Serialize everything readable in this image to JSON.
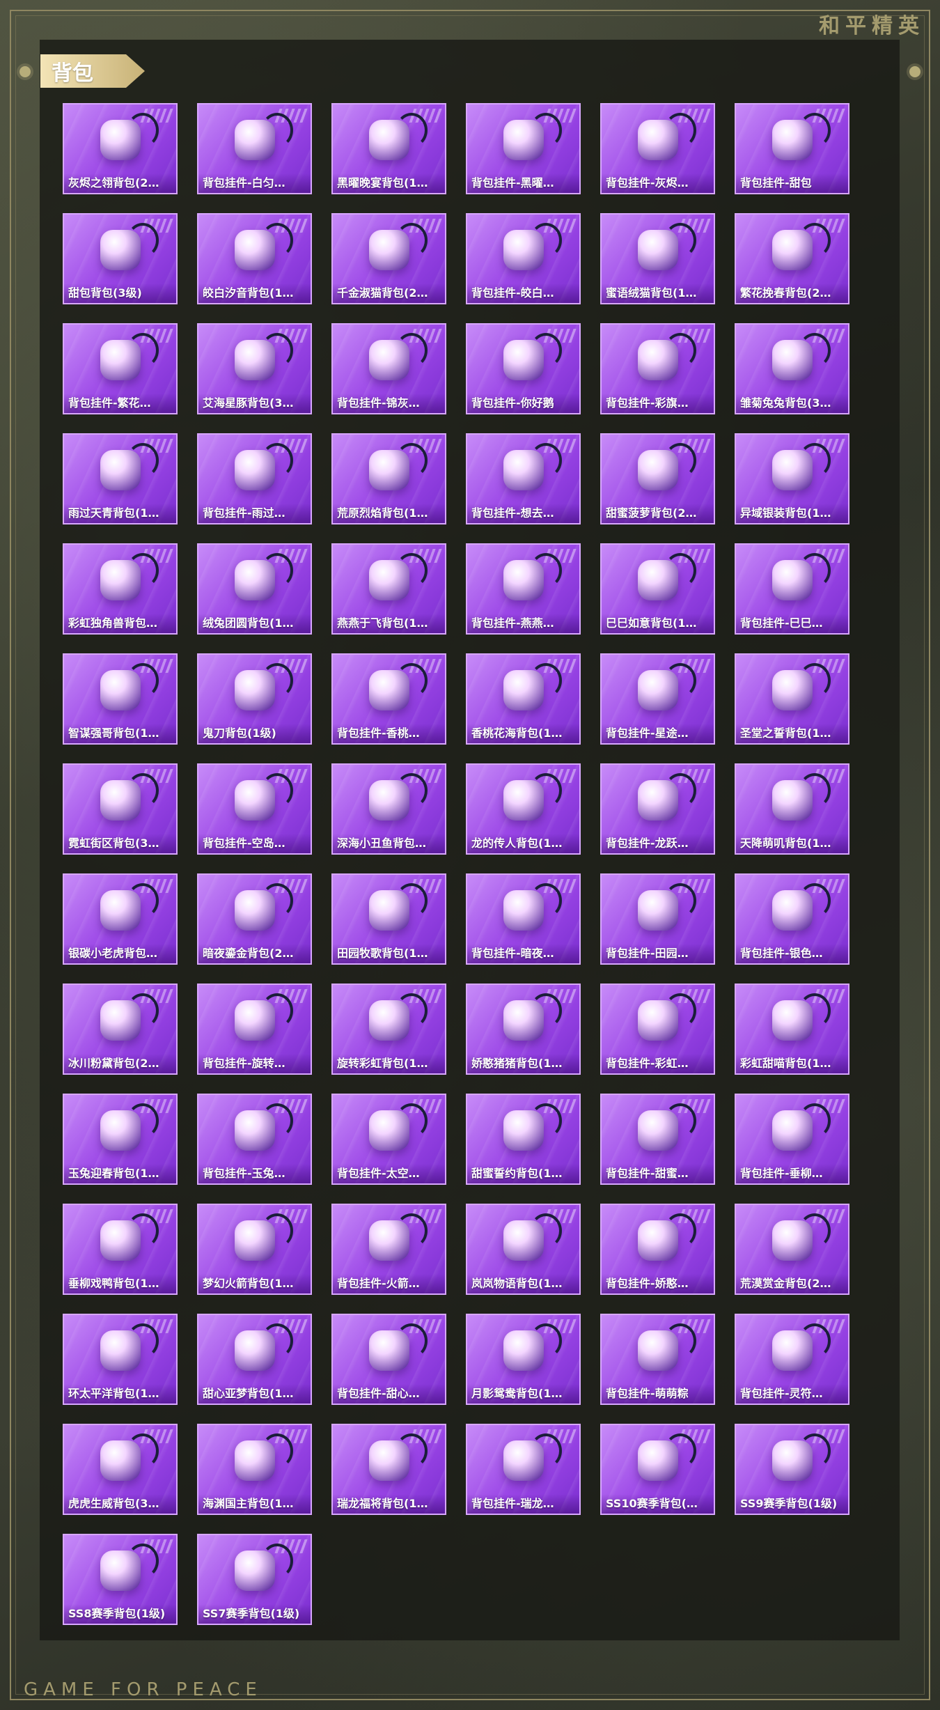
{
  "brand": "和平精英",
  "footer": "GAME FOR PEACE",
  "section_title": "背包",
  "items": [
    "灰烬之翎背包(2…",
    "背包挂件-白匀…",
    "黑曜晚宴背包(1…",
    "背包挂件-黑曜…",
    "背包挂件-灰烬…",
    "背包挂件-甜包",
    "甜包背包(3级)",
    "皎白汐音背包(1…",
    "千金淑猫背包(2…",
    "背包挂件-皎白…",
    "蜜语绒猫背包(1…",
    "繁花挽春背包(2…",
    "背包挂件-繁花…",
    "艾海星豚背包(3…",
    "背包挂件-锦灰…",
    "背包挂件-你好鹅",
    "背包挂件-彩旗…",
    "雏菊兔兔背包(3…",
    "雨过天青背包(1…",
    "背包挂件-雨过…",
    "荒原烈焰背包(1…",
    "背包挂件-想去…",
    "甜蜜菠萝背包(2…",
    "异域银装背包(1…",
    "彩虹独角兽背包…",
    "绒兔团圆背包(1…",
    "燕燕于飞背包(1…",
    "背包挂件-燕燕…",
    "巳巳如意背包(1…",
    "背包挂件-巳巳…",
    "智谋强哥背包(1…",
    "鬼刀背包(1级)",
    "背包挂件-香桃…",
    "香桃花海背包(1…",
    "背包挂件-星途…",
    "圣堂之誓背包(1…",
    "霓虹街区背包(3…",
    "背包挂件-空岛…",
    "深海小丑鱼背包…",
    "龙的传人背包(1…",
    "背包挂件-龙跃…",
    "天降萌叽背包(1…",
    "银碳小老虎背包…",
    "暗夜鎏金背包(2…",
    "田园牧歌背包(1…",
    "背包挂件-暗夜…",
    "背包挂件-田园…",
    "背包挂件-银色…",
    "冰川粉黛背包(2…",
    "背包挂件-旋转…",
    "旋转彩虹背包(1…",
    "娇憨猪猪背包(1…",
    "背包挂件-彩虹…",
    "彩虹甜喵背包(1…",
    "玉兔迎春背包(1…",
    "背包挂件-玉兔…",
    "背包挂件-太空…",
    "甜蜜誓约背包(1…",
    "背包挂件-甜蜜…",
    "背包挂件-垂柳…",
    "垂柳戏鸭背包(1…",
    "梦幻火箭背包(1…",
    "背包挂件-火箭…",
    "岚岚物语背包(1…",
    "背包挂件-娇憨…",
    "荒漠赏金背包(2…",
    "环太平洋背包(1…",
    "甜心亚梦背包(1…",
    "背包挂件-甜心…",
    "月影鸳鸯背包(1…",
    "背包挂件-萌萌粽",
    "背包挂件-灵符…",
    "虎虎生威背包(3…",
    "海渊国主背包(1…",
    "瑞龙福将背包(1…",
    "背包挂件-瑞龙…",
    "SS10赛季背包(…",
    "SS9赛季背包(1级)",
    "SS8赛季背包(1级)",
    "SS7赛季背包(1级)"
  ]
}
